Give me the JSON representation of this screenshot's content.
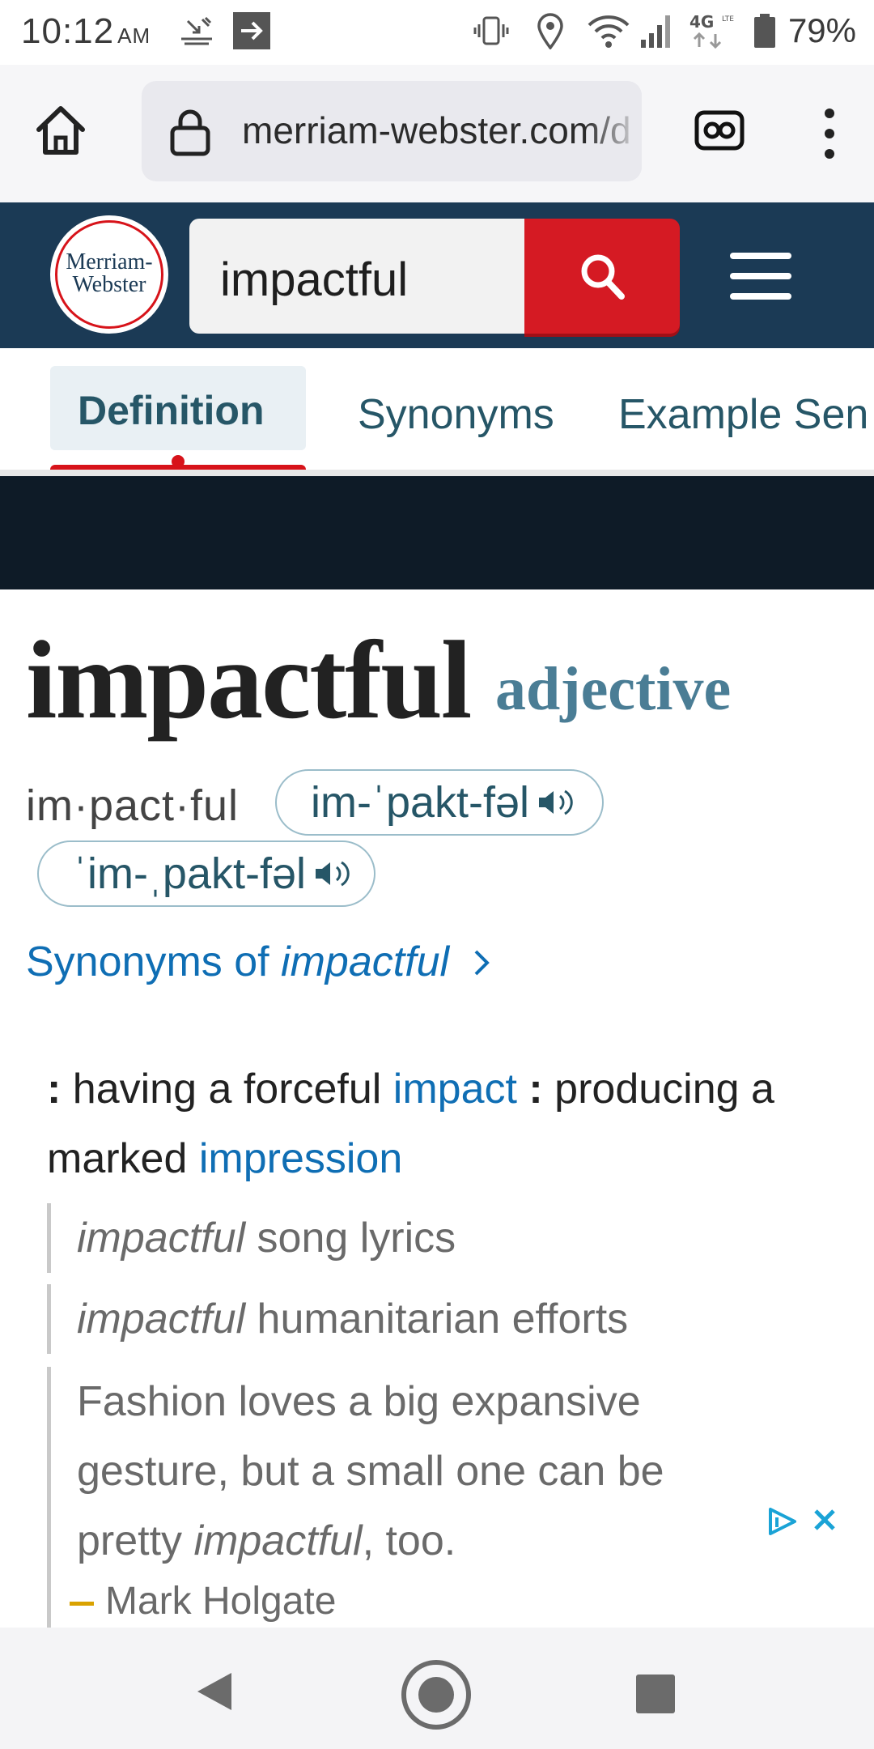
{
  "status_bar": {
    "time": "10:12",
    "ampm": "AM",
    "network_label": "4G LTE",
    "battery": "79%"
  },
  "browser": {
    "url": "merriam-webster.com/d"
  },
  "header": {
    "logo_line1": "Merriam-",
    "logo_line2": "Webster",
    "search_value": "impactful"
  },
  "tabs": [
    {
      "label": "Definition"
    },
    {
      "label": "Synonyms"
    },
    {
      "label": "Example Sen"
    }
  ],
  "entry": {
    "headword": "impactful",
    "part_of_speech": "adjective",
    "syllables": "im·pact·ful",
    "pronunciations": [
      "im-ˈpakt-fəl",
      "ˈim-ˌpakt-fəl"
    ],
    "synonyms_link_prefix": "Synonyms of ",
    "synonyms_link_word": "impactful",
    "definition": {
      "colon1": ":",
      "part1": " having a forceful ",
      "xref1": "impact",
      "colon2": " :",
      "part2": " producing a marked ",
      "xref2": "impression"
    },
    "examples": [
      {
        "italic": "impactful",
        "rest": " song lyrics"
      },
      {
        "italic": "impactful",
        "rest": " humanitarian efforts"
      },
      {
        "prefix": "Fashion loves a big expansive gesture, but a small one can be pretty ",
        "italic": "impactful",
        "rest": ", too."
      }
    ],
    "citation": "Mark Holgate"
  },
  "colors": {
    "header_bg": "#1b3a55",
    "search_button": "#d51a23",
    "link": "#0f6eb4",
    "pos": "#4a7d95"
  }
}
